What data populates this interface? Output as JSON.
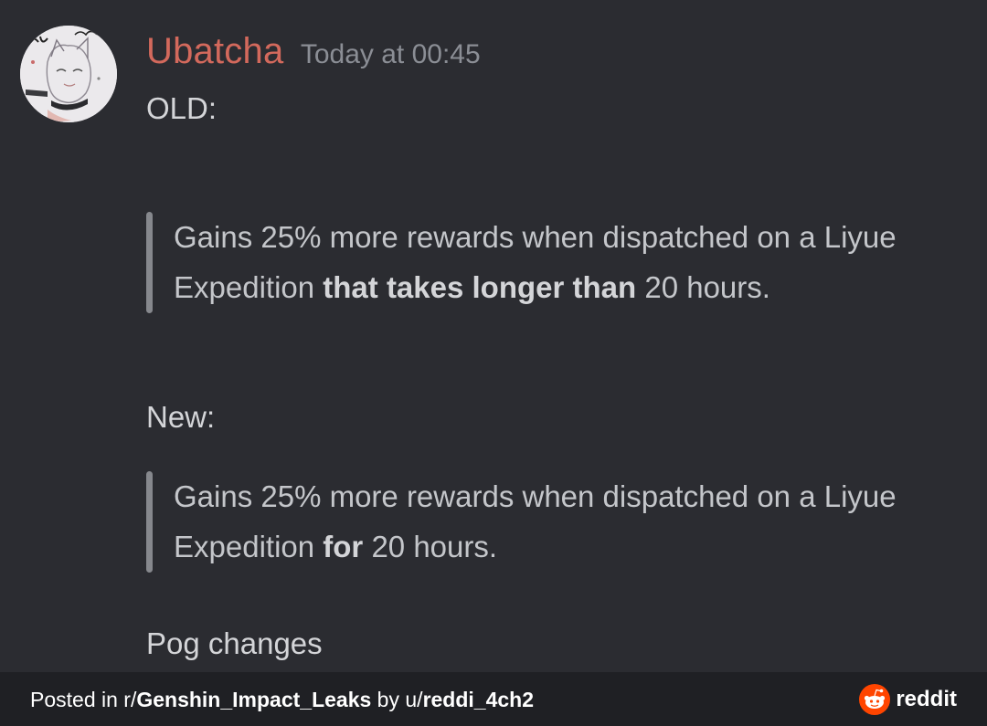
{
  "message": {
    "author": "Ubatcha",
    "timestamp": "Today at 00:45",
    "old_label": "OLD:",
    "old_quote": {
      "line1": "Gains 25% more rewards when dispatched on a Liyue",
      "line2_pre": "Expedition ",
      "line2_bold": "that takes longer than",
      "line2_post": " 20 hours."
    },
    "new_label": "New:",
    "new_quote": {
      "line1": "Gains 25% more rewards when dispatched on a Liyue",
      "line2_pre": "Expedition ",
      "line2_bold": "for",
      "line2_post": " 20 hours."
    },
    "closing": "Pog changes"
  },
  "footer": {
    "posted_in": "Posted in r/",
    "subreddit": "Genshin_Impact_Leaks",
    "by": " by u/",
    "user": "reddi_4ch2",
    "brand": "reddit",
    "brand_icon": "reddit-alien-icon"
  },
  "colors": {
    "background": "#2b2c31",
    "author": "#d3695c",
    "footer_background": "#1f2024",
    "reddit_orange": "#ff4500"
  }
}
